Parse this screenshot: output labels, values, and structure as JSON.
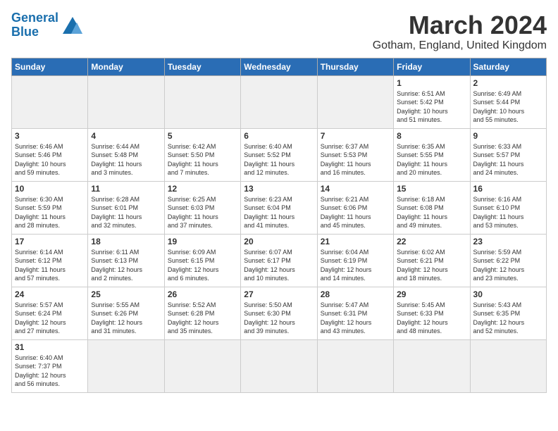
{
  "header": {
    "logo_general": "General",
    "logo_blue": "Blue",
    "title": "March 2024",
    "subtitle": "Gotham, England, United Kingdom"
  },
  "weekdays": [
    "Sunday",
    "Monday",
    "Tuesday",
    "Wednesday",
    "Thursday",
    "Friday",
    "Saturday"
  ],
  "weeks": [
    [
      {
        "day": "",
        "info": ""
      },
      {
        "day": "",
        "info": ""
      },
      {
        "day": "",
        "info": ""
      },
      {
        "day": "",
        "info": ""
      },
      {
        "day": "",
        "info": ""
      },
      {
        "day": "1",
        "info": "Sunrise: 6:51 AM\nSunset: 5:42 PM\nDaylight: 10 hours\nand 51 minutes."
      },
      {
        "day": "2",
        "info": "Sunrise: 6:49 AM\nSunset: 5:44 PM\nDaylight: 10 hours\nand 55 minutes."
      }
    ],
    [
      {
        "day": "3",
        "info": "Sunrise: 6:46 AM\nSunset: 5:46 PM\nDaylight: 10 hours\nand 59 minutes."
      },
      {
        "day": "4",
        "info": "Sunrise: 6:44 AM\nSunset: 5:48 PM\nDaylight: 11 hours\nand 3 minutes."
      },
      {
        "day": "5",
        "info": "Sunrise: 6:42 AM\nSunset: 5:50 PM\nDaylight: 11 hours\nand 7 minutes."
      },
      {
        "day": "6",
        "info": "Sunrise: 6:40 AM\nSunset: 5:52 PM\nDaylight: 11 hours\nand 12 minutes."
      },
      {
        "day": "7",
        "info": "Sunrise: 6:37 AM\nSunset: 5:53 PM\nDaylight: 11 hours\nand 16 minutes."
      },
      {
        "day": "8",
        "info": "Sunrise: 6:35 AM\nSunset: 5:55 PM\nDaylight: 11 hours\nand 20 minutes."
      },
      {
        "day": "9",
        "info": "Sunrise: 6:33 AM\nSunset: 5:57 PM\nDaylight: 11 hours\nand 24 minutes."
      }
    ],
    [
      {
        "day": "10",
        "info": "Sunrise: 6:30 AM\nSunset: 5:59 PM\nDaylight: 11 hours\nand 28 minutes."
      },
      {
        "day": "11",
        "info": "Sunrise: 6:28 AM\nSunset: 6:01 PM\nDaylight: 11 hours\nand 32 minutes."
      },
      {
        "day": "12",
        "info": "Sunrise: 6:25 AM\nSunset: 6:03 PM\nDaylight: 11 hours\nand 37 minutes."
      },
      {
        "day": "13",
        "info": "Sunrise: 6:23 AM\nSunset: 6:04 PM\nDaylight: 11 hours\nand 41 minutes."
      },
      {
        "day": "14",
        "info": "Sunrise: 6:21 AM\nSunset: 6:06 PM\nDaylight: 11 hours\nand 45 minutes."
      },
      {
        "day": "15",
        "info": "Sunrise: 6:18 AM\nSunset: 6:08 PM\nDaylight: 11 hours\nand 49 minutes."
      },
      {
        "day": "16",
        "info": "Sunrise: 6:16 AM\nSunset: 6:10 PM\nDaylight: 11 hours\nand 53 minutes."
      }
    ],
    [
      {
        "day": "17",
        "info": "Sunrise: 6:14 AM\nSunset: 6:12 PM\nDaylight: 11 hours\nand 57 minutes."
      },
      {
        "day": "18",
        "info": "Sunrise: 6:11 AM\nSunset: 6:13 PM\nDaylight: 12 hours\nand 2 minutes."
      },
      {
        "day": "19",
        "info": "Sunrise: 6:09 AM\nSunset: 6:15 PM\nDaylight: 12 hours\nand 6 minutes."
      },
      {
        "day": "20",
        "info": "Sunrise: 6:07 AM\nSunset: 6:17 PM\nDaylight: 12 hours\nand 10 minutes."
      },
      {
        "day": "21",
        "info": "Sunrise: 6:04 AM\nSunset: 6:19 PM\nDaylight: 12 hours\nand 14 minutes."
      },
      {
        "day": "22",
        "info": "Sunrise: 6:02 AM\nSunset: 6:21 PM\nDaylight: 12 hours\nand 18 minutes."
      },
      {
        "day": "23",
        "info": "Sunrise: 5:59 AM\nSunset: 6:22 PM\nDaylight: 12 hours\nand 23 minutes."
      }
    ],
    [
      {
        "day": "24",
        "info": "Sunrise: 5:57 AM\nSunset: 6:24 PM\nDaylight: 12 hours\nand 27 minutes."
      },
      {
        "day": "25",
        "info": "Sunrise: 5:55 AM\nSunset: 6:26 PM\nDaylight: 12 hours\nand 31 minutes."
      },
      {
        "day": "26",
        "info": "Sunrise: 5:52 AM\nSunset: 6:28 PM\nDaylight: 12 hours\nand 35 minutes."
      },
      {
        "day": "27",
        "info": "Sunrise: 5:50 AM\nSunset: 6:30 PM\nDaylight: 12 hours\nand 39 minutes."
      },
      {
        "day": "28",
        "info": "Sunrise: 5:47 AM\nSunset: 6:31 PM\nDaylight: 12 hours\nand 43 minutes."
      },
      {
        "day": "29",
        "info": "Sunrise: 5:45 AM\nSunset: 6:33 PM\nDaylight: 12 hours\nand 48 minutes."
      },
      {
        "day": "30",
        "info": "Sunrise: 5:43 AM\nSunset: 6:35 PM\nDaylight: 12 hours\nand 52 minutes."
      }
    ],
    [
      {
        "day": "31",
        "info": "Sunrise: 6:40 AM\nSunset: 7:37 PM\nDaylight: 12 hours\nand 56 minutes."
      },
      {
        "day": "",
        "info": ""
      },
      {
        "day": "",
        "info": ""
      },
      {
        "day": "",
        "info": ""
      },
      {
        "day": "",
        "info": ""
      },
      {
        "day": "",
        "info": ""
      },
      {
        "day": "",
        "info": ""
      }
    ]
  ]
}
